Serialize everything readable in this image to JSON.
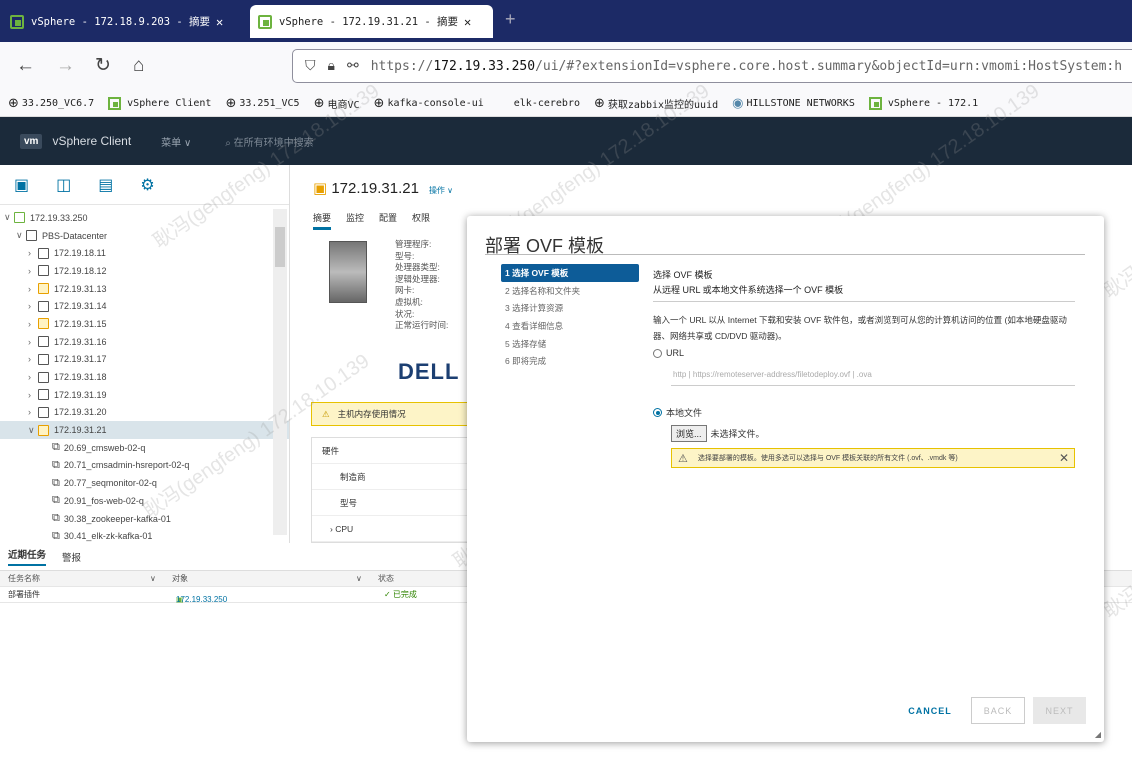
{
  "browser": {
    "tabs": [
      {
        "title": "vSphere - 172.18.9.203 - 摘要"
      },
      {
        "title": "vSphere - 172.19.31.21 - 摘要"
      }
    ],
    "url_prefix": "https://",
    "url_host": "172.19.33.250",
    "url_rest": "/ui/#?extensionId=vsphere.core.host.summary&objectId=urn:vmomi:HostSystem:h",
    "bookmarks": [
      "33.250_VC6.7",
      "vSphere Client",
      "33.251_VC5",
      "电商VC",
      "kafka-console-ui",
      "elk-cerebro",
      "获取zabbix监控的uuid",
      "HILLSTONE NETWORKS",
      "vSphere - 172.1"
    ]
  },
  "header": {
    "logo": "vm",
    "title": "vSphere Client",
    "menu": "菜单 ∨",
    "search": "在所有环境中搜索"
  },
  "tree": {
    "root": "172.19.33.250",
    "dc": "PBS-Datacenter",
    "hosts": [
      "172.19.18.11",
      "172.19.18.12",
      "172.19.31.13",
      "172.19.31.14",
      "172.19.31.15",
      "172.19.31.16",
      "172.19.31.17",
      "172.19.31.18",
      "172.19.31.19",
      "172.19.31.20",
      "172.19.31.21"
    ],
    "vms": [
      "20.69_cmsweb-02-q",
      "20.71_cmsadmin-hsreport-02-q",
      "20.77_seqmonitor-02-q",
      "20.91_fos-web-02-q",
      "30.38_zookeeper-kafka-01",
      "30.41_elk-zk-kafka-01"
    ]
  },
  "host": {
    "title": "172.19.31.21",
    "actions": "操作 ∨",
    "tabs": [
      "摘要",
      "监控",
      "配置",
      "权限"
    ],
    "props": [
      "管理程序:",
      "型号:",
      "处理器类型:",
      "逻辑处理器:",
      "网卡:",
      "虚拟机:",
      "状况:",
      "正常运行时间:"
    ],
    "brand": "DELL",
    "warning": "主机内存使用情况",
    "hw_title": "硬件",
    "hw_rows": [
      "制造商",
      "型号",
      "› CPU"
    ]
  },
  "tasks": {
    "tabs": [
      "近期任务",
      "警报"
    ],
    "cols": [
      "任务名称",
      "对象",
      "状态"
    ],
    "row": {
      "name": "部署插件",
      "object": "172.19.33.250",
      "status": "✓ 已完成"
    }
  },
  "modal": {
    "title": "部署 OVF 模板",
    "steps": [
      "1 选择 OVF 模板",
      "2 选择名称和文件夹",
      "3 选择计算资源",
      "4 查看详细信息",
      "5 选择存储",
      "6 即将完成"
    ],
    "heading": "选择 OVF 模板",
    "subheading": "从远程 URL 或本地文件系统选择一个 OVF 模板",
    "desc": "输入一个 URL 以从 Internet 下载和安装 OVF 软件包，或者浏览到可从您的计算机访问的位置 (如本地硬盘驱动器、网络共享或 CD/DVD 驱动器)。",
    "url_label": "URL",
    "url_placeholder": "http | https://remoteserver-address/filetodeploy.ovf | .ova",
    "local_label": "本地文件",
    "browse": "浏览...",
    "no_file": "未选择文件。",
    "alert": "选择要部署的模板。使用多选可以选择与 OVF 模板关联的所有文件 (.ovf、.vmdk 等)",
    "cancel": "CANCEL",
    "back": "BACK",
    "next": "NEXT"
  },
  "watermark": "耿冯(gengfeng) 172.18.10.139"
}
